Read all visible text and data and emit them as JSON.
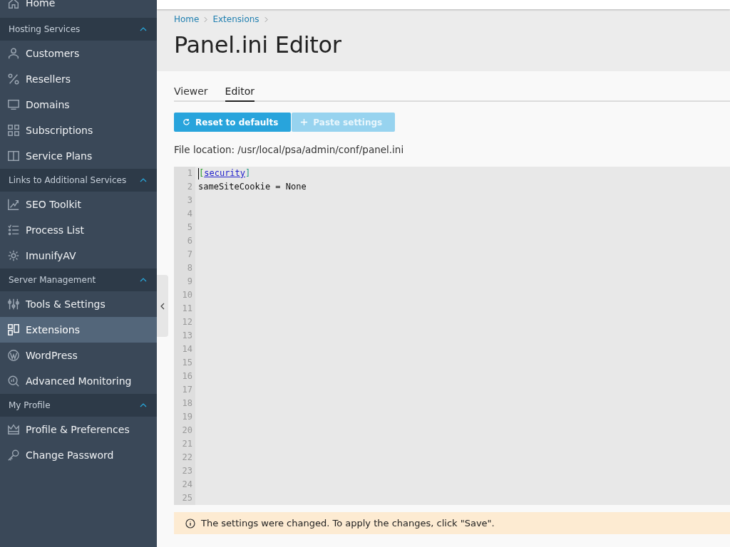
{
  "sidebar": {
    "top_item": {
      "label": "Home",
      "selected": false
    },
    "groups": [
      {
        "title": "Hosting Services",
        "expanded": true,
        "items": [
          {
            "label": "Customers",
            "selected": false
          },
          {
            "label": "Resellers",
            "selected": false
          },
          {
            "label": "Domains",
            "selected": false
          },
          {
            "label": "Subscriptions",
            "selected": false
          },
          {
            "label": "Service Plans",
            "selected": false
          }
        ]
      },
      {
        "title": "Links to Additional Services",
        "expanded": true,
        "items": [
          {
            "label": "SEO Toolkit",
            "selected": false
          },
          {
            "label": "Process List",
            "selected": false
          },
          {
            "label": "ImunifyAV",
            "selected": false
          }
        ]
      },
      {
        "title": "Server Management",
        "expanded": true,
        "items": [
          {
            "label": "Tools & Settings",
            "selected": false
          },
          {
            "label": "Extensions",
            "selected": true
          },
          {
            "label": "WordPress",
            "selected": false
          },
          {
            "label": "Advanced Monitoring",
            "selected": false
          }
        ]
      },
      {
        "title": "My Profile",
        "expanded": true,
        "items": [
          {
            "label": "Profile & Preferences",
            "selected": false
          },
          {
            "label": "Change Password",
            "selected": false
          }
        ]
      }
    ]
  },
  "breadcrumbs": [
    "Home",
    "Extensions"
  ],
  "title": "Panel.ini Editor",
  "tabs": [
    {
      "label": "Viewer",
      "selected": false
    },
    {
      "label": "Editor",
      "selected": true
    }
  ],
  "buttons": [
    {
      "label": "Reset to defaults",
      "disabled": false
    },
    {
      "label": "Paste settings",
      "disabled": true
    }
  ],
  "file_location": "File location: /usr/local/psa/admin/conf/panel.ini",
  "editor": {
    "lines": [
      {
        "number": "1",
        "kind": "section",
        "text": "[security]"
      },
      {
        "number": "2",
        "kind": "plain",
        "text": "sameSiteCookie = None"
      },
      {
        "number": "3",
        "kind": "plain"
      },
      {
        "number": "4",
        "kind": "plain"
      },
      {
        "number": "5",
        "kind": "plain"
      },
      {
        "number": "6",
        "kind": "plain"
      },
      {
        "number": "7",
        "kind": "plain"
      },
      {
        "number": "8",
        "kind": "plain"
      },
      {
        "number": "9",
        "kind": "plain"
      },
      {
        "number": "10",
        "kind": "plain"
      },
      {
        "number": "11",
        "kind": "plain"
      },
      {
        "number": "12",
        "kind": "plain"
      },
      {
        "number": "13",
        "kind": "plain"
      },
      {
        "number": "14",
        "kind": "plain"
      },
      {
        "number": "15",
        "kind": "plain"
      },
      {
        "number": "16",
        "kind": "plain"
      },
      {
        "number": "17",
        "kind": "plain"
      },
      {
        "number": "18",
        "kind": "plain"
      },
      {
        "number": "19",
        "kind": "plain"
      },
      {
        "number": "20",
        "kind": "plain"
      },
      {
        "number": "21",
        "kind": "plain"
      },
      {
        "number": "22",
        "kind": "plain"
      },
      {
        "number": "23",
        "kind": "plain"
      },
      {
        "number": "24",
        "kind": "plain"
      },
      {
        "number": "25",
        "kind": "plain"
      }
    ]
  },
  "notice": {
    "text": "The settings were changed. To apply the changes, click \"Save\"."
  }
}
